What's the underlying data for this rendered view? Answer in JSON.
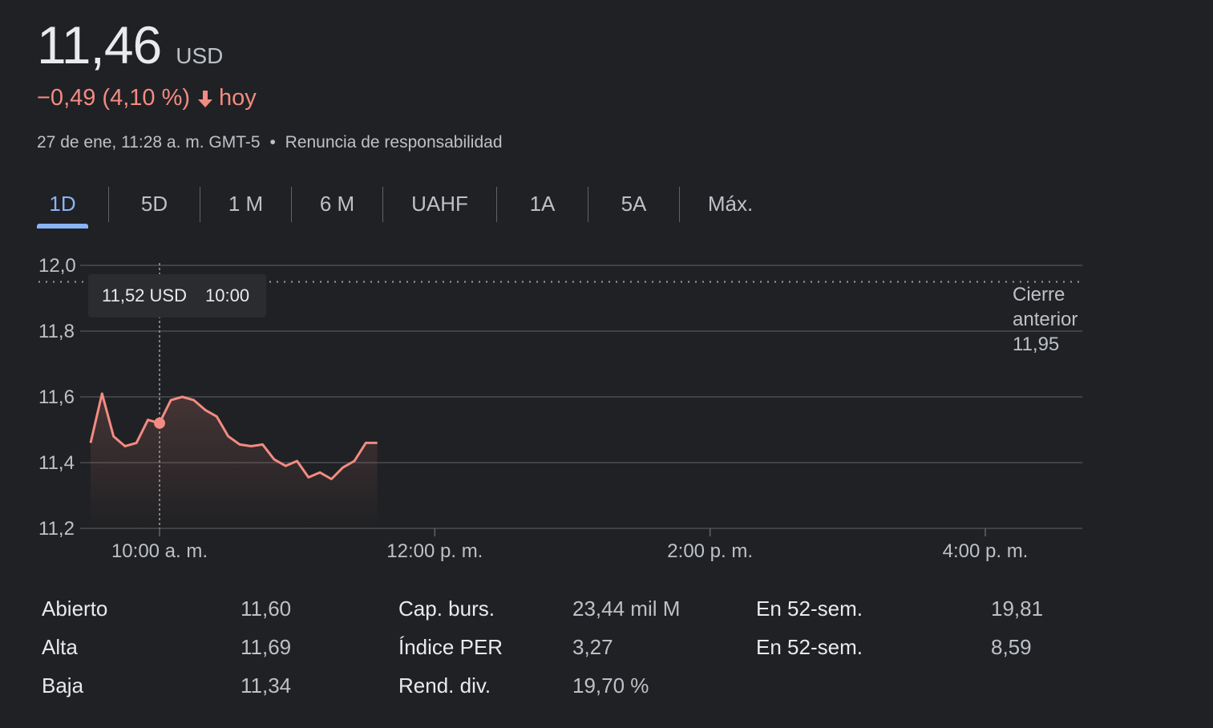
{
  "quote": {
    "price": "11,46",
    "currency": "USD",
    "change": "−0,49 (4,10 %)",
    "change_period": "hoy",
    "timestamp": "27 de ene, 11:28 a. m. GMT-5",
    "separator": "•",
    "disclaimer": "Renuncia de responsabilidad"
  },
  "tabs": [
    {
      "label": "1D",
      "active": true
    },
    {
      "label": "5D"
    },
    {
      "label": "1 M"
    },
    {
      "label": "6 M"
    },
    {
      "label": "UAHF"
    },
    {
      "label": "1A"
    },
    {
      "label": "5A"
    },
    {
      "label": "Máx."
    }
  ],
  "colors": {
    "line": "#f28b82",
    "accent": "#8ab4f8",
    "background": "#202124"
  },
  "chart_data": {
    "type": "line",
    "y_ticks": [
      "12,0",
      "11,8",
      "11,6",
      "11,4",
      "11,2"
    ],
    "ylim": [
      11.2,
      12.0
    ],
    "x_ticks": [
      "10:00 a. m.",
      "12:00 p. m.",
      "2:00 p. m.",
      "4:00 p. m."
    ],
    "xlim": [
      "9:30",
      "16:30"
    ],
    "grid": true,
    "previous_close": {
      "label_1": "Cierre",
      "label_2": "anterior",
      "value": "11,95",
      "y": 11.95
    },
    "tooltip": {
      "price": "11,52 USD",
      "time": "10:00",
      "x": "10:00",
      "y": 11.52
    },
    "series": [
      {
        "x": [
          "9:30",
          "9:35",
          "9:40",
          "9:45",
          "9:50",
          "9:55",
          "10:00",
          "10:05",
          "10:10",
          "10:15",
          "10:20",
          "10:25",
          "10:30",
          "10:35",
          "10:40",
          "10:45",
          "10:50",
          "10:55",
          "11:00",
          "11:05",
          "11:10",
          "11:15",
          "11:20",
          "11:25",
          "11:30",
          "11:35"
        ],
        "y": [
          11.46,
          11.61,
          11.48,
          11.45,
          11.46,
          11.53,
          11.52,
          11.59,
          11.6,
          11.59,
          11.56,
          11.54,
          11.48,
          11.455,
          11.45,
          11.455,
          11.41,
          11.39,
          11.405,
          11.355,
          11.37,
          11.35,
          11.385,
          11.405,
          11.46,
          11.46
        ]
      }
    ]
  },
  "stats": {
    "col1": [
      {
        "label": "Abierto",
        "value": "11,60"
      },
      {
        "label": "Alta",
        "value": "11,69"
      },
      {
        "label": "Baja",
        "value": "11,34"
      }
    ],
    "col2": [
      {
        "label": "Cap. burs.",
        "value": "23,44 mil M"
      },
      {
        "label": "Índice PER",
        "value": "3,27"
      },
      {
        "label": "Rend. div.",
        "value": "19,70 %"
      }
    ],
    "col3": [
      {
        "label": "En 52-sem.",
        "value": "19,81"
      },
      {
        "label": "En 52-sem.",
        "value": "8,59"
      }
    ]
  }
}
